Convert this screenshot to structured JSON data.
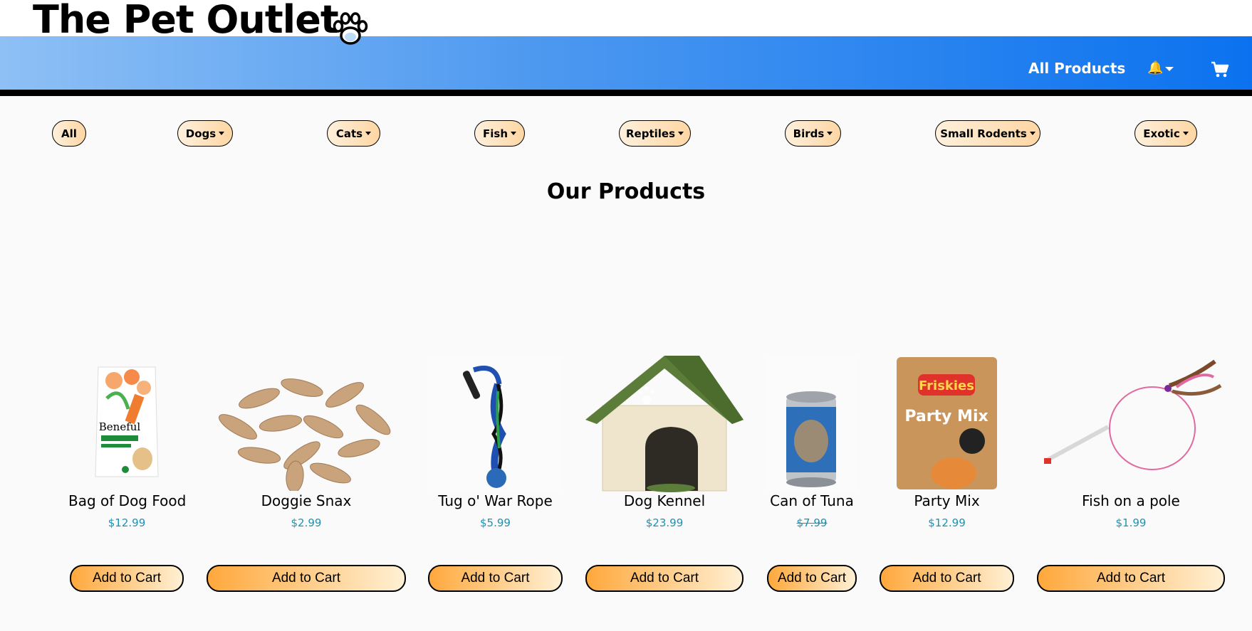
{
  "header": {
    "brand": "The Pet Outlet"
  },
  "nav": {
    "all_products": "All Products",
    "bell": "🔔"
  },
  "categories": [
    "All",
    "Dogs",
    "Cats",
    "Fish",
    "Reptiles",
    "Birds",
    "Small Rodents",
    "Exotic"
  ],
  "main": {
    "title": "Our Products"
  },
  "products": [
    {
      "name": "Bag of Dog Food",
      "price": "$12.99",
      "button": "Add to Cart"
    },
    {
      "name": "Doggie Snax",
      "price": "$2.99",
      "button": "Add to Cart"
    },
    {
      "name": "Tug o' War Rope",
      "price": "$5.99",
      "button": "Add to Cart"
    },
    {
      "name": "Dog Kennel",
      "price": "$23.99",
      "button": "Add to Cart"
    },
    {
      "name": "Can of Tuna",
      "price": "$7.99",
      "button": "Add to Cart"
    },
    {
      "name": "Party Mix",
      "price": "$12.99",
      "button": "Add to Cart"
    },
    {
      "name": "Fish on a pole",
      "price": "$1.99",
      "button": "Add to Cart"
    }
  ],
  "product_image_text": {
    "food_brand": "Beneful",
    "treat_brand": "Friskies",
    "treat_line": "Party Mix"
  },
  "colors": {
    "nav_start": "#8ec0f5",
    "nav_end": "#0b72ef",
    "button_orange": "#ffa83c",
    "price_teal": "#1a94b3"
  }
}
